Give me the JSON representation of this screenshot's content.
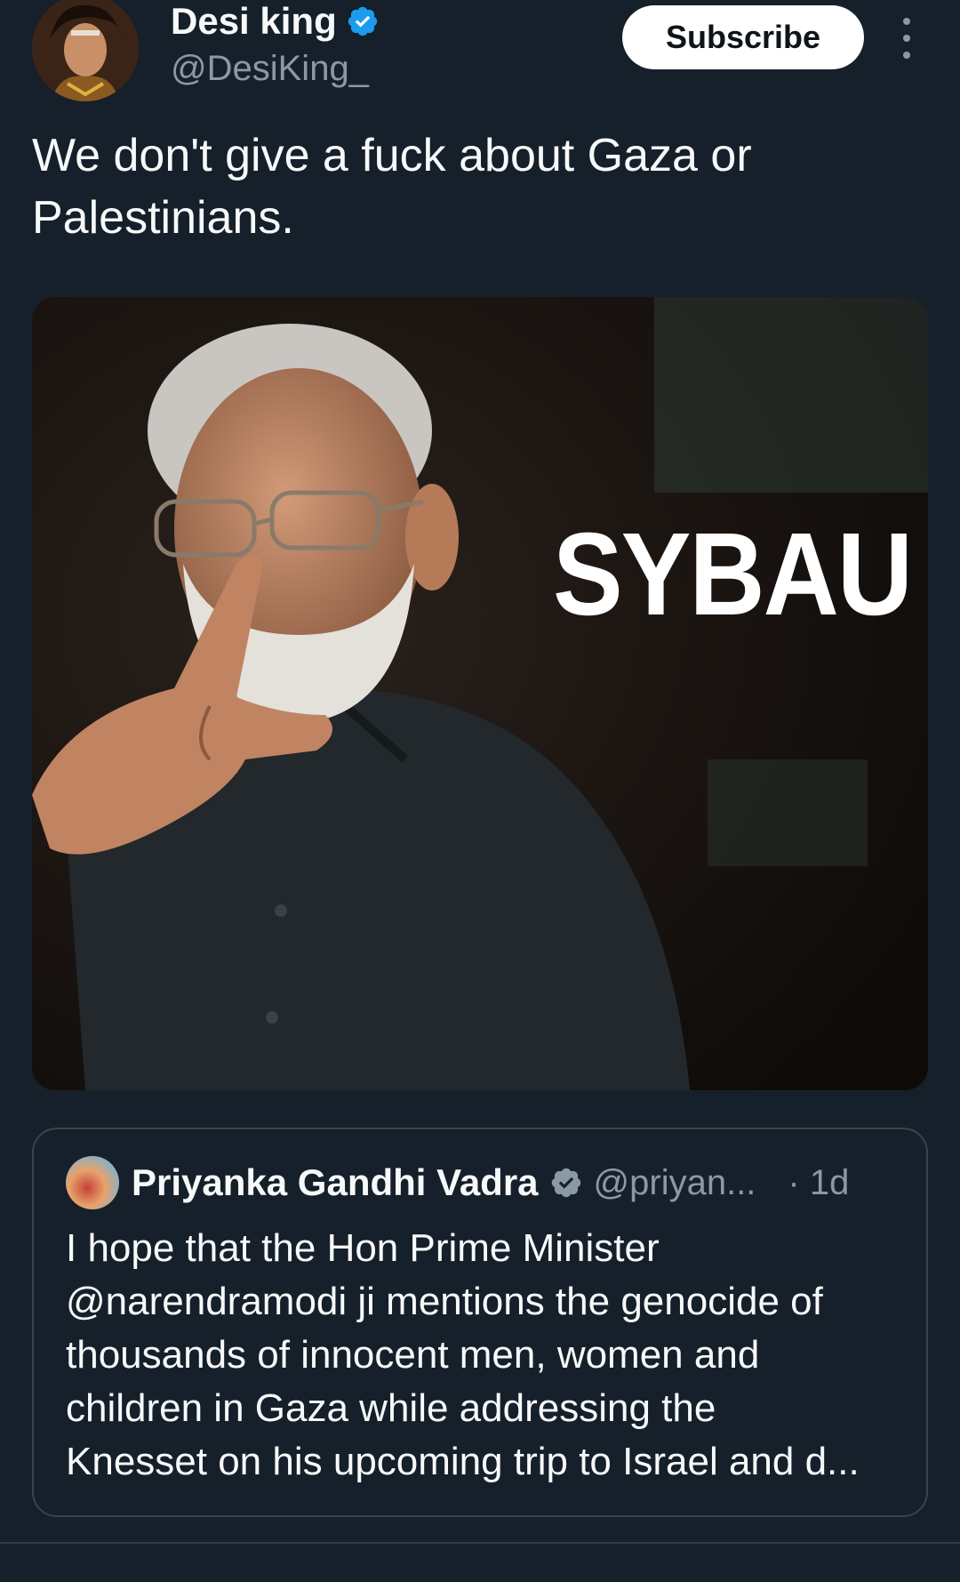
{
  "author": {
    "display_name": "Desi king",
    "handle": "@DesiKing_",
    "verified_icon": "verified-badge-icon",
    "avatar_icon": "avatar-image"
  },
  "actions": {
    "subscribe_label": "Subscribe",
    "more_icon": "more-options-icon"
  },
  "tweet": {
    "text_line1": "We don't give a fuck about Gaza or",
    "text_line2": "Palestinians."
  },
  "media": {
    "overlay_text": "SYBAU"
  },
  "quoted_tweet": {
    "display_name": "Priyanka Gandhi Vadra",
    "handle": "@priyan...",
    "time": "· 1d",
    "lines": [
      "I hope that the Hon Prime Minister",
      "@narendramodi ji mentions the genocide of",
      "thousands of innocent men, women and",
      "children in Gaza while addressing the",
      "Knesset on his upcoming trip to Israel and d..."
    ]
  },
  "colors": {
    "background": "#15202b",
    "verified": "#1d9bf0",
    "verified_gray": "#8b98a5",
    "text_primary": "#f7f9f9",
    "text_secondary": "#8b98a5",
    "border": "#38444d"
  }
}
